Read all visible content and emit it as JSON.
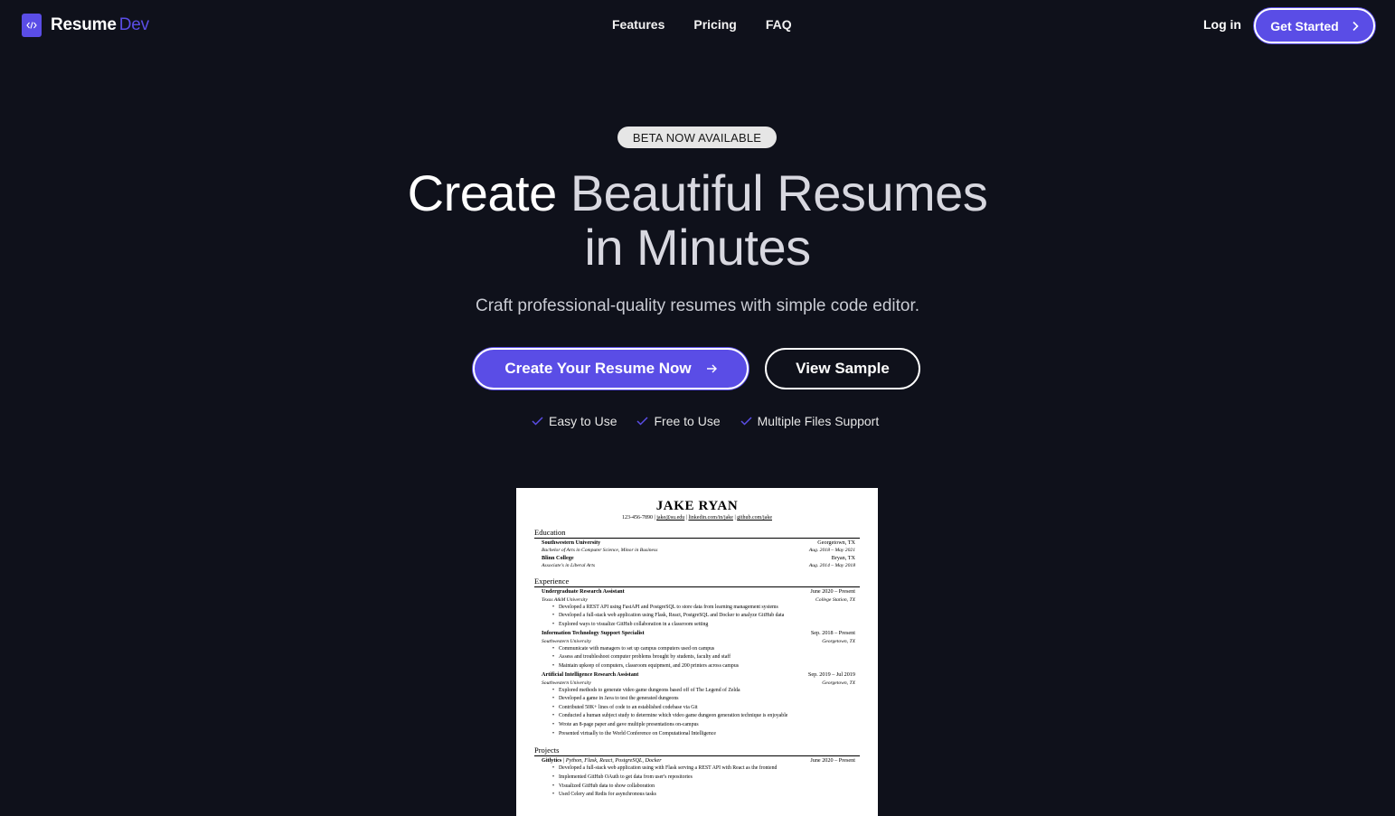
{
  "nav": {
    "brand_main": "Resume",
    "brand_accent": "Dev",
    "links": [
      "Features",
      "Pricing",
      "FAQ"
    ],
    "login": "Log in",
    "cta": "Get Started"
  },
  "hero": {
    "badge": "BETA NOW AVAILABLE",
    "headline_a": "Create",
    "headline_b": "Beautiful Resumes",
    "headline_c": "in Minutes",
    "subtitle": "Craft professional-quality resumes with simple code editor.",
    "primary_button": "Create Your Resume Now",
    "secondary_button": "View Sample",
    "features": [
      "Easy to Use",
      "Free to Use",
      "Multiple Files Support"
    ]
  },
  "colors": {
    "accent": "#5a4de6",
    "background": "#0f111b"
  },
  "resume": {
    "name": "JAKE RYAN",
    "phone": "123-456-7890",
    "email": "jake@su.edu",
    "linkedin": "linkedin.com/in/jake",
    "github": "github.com/jake",
    "sections": {
      "education": "Education",
      "experience": "Experience",
      "projects": "Projects"
    },
    "education": [
      {
        "school": "Southwestern University",
        "location": "Georgetown, TX",
        "degree": "Bachelor of Arts in Computer Science, Minor in Business",
        "dates": "Aug. 2018 – May 2021"
      },
      {
        "school": "Blinn College",
        "location": "Bryan, TX",
        "degree": "Associate's in Liberal Arts",
        "dates": "Aug. 2014 – May 2018"
      }
    ],
    "experience": [
      {
        "title": "Undergraduate Research Assistant",
        "dates": "June 2020 – Present",
        "org": "Texas A&M University",
        "location": "College Station, TX",
        "bullets": [
          "Developed a REST API using FastAPI and PostgreSQL to store data from learning management systems",
          "Developed a full-stack web application using Flask, React, PostgreSQL and Docker to analyze GitHub data",
          "Explored ways to visualize GitHub collaboration in a classroom setting"
        ]
      },
      {
        "title": "Information Technology Support Specialist",
        "dates": "Sep. 2018 – Present",
        "org": "Southwestern University",
        "location": "Georgetown, TX",
        "bullets": [
          "Communicate with managers to set up campus computers used on campus",
          "Assess and troubleshoot computer problems brought by students, faculty and staff",
          "Maintain upkeep of computers, classroom equipment, and 200 printers across campus"
        ]
      },
      {
        "title": "Artificial Intelligence Research Assistant",
        "dates": "Sep. 2019 – Jul 2019",
        "org": "Southwestern University",
        "location": "Georgetown, TX",
        "bullets": [
          "Explored methods to generate video game dungeons based off of The Legend of Zelda",
          "Developed a game in Java to test the generated dungeons",
          "Contributed 50K+ lines of code to an established codebase via Git",
          "Conducted a human subject study to determine which video game dungeon generation technique is enjoyable",
          "Wrote an 8-page paper and gave multiple presentations on-campus",
          "Presented virtually to the World Conference on Computational Intelligence"
        ]
      }
    ],
    "project": {
      "name": "Gitlytics",
      "stack": "Python, Flask, React, PostgreSQL, Docker",
      "dates": "June 2020 – Present",
      "bullets": [
        "Developed a full-stack web application using with Flask serving a REST API with React as the frontend",
        "Implemented GitHub OAuth to get data from user's repositories",
        "Visualized GitHub data to show collaboration",
        "Used Celery and Redis for asynchronous tasks"
      ]
    }
  }
}
